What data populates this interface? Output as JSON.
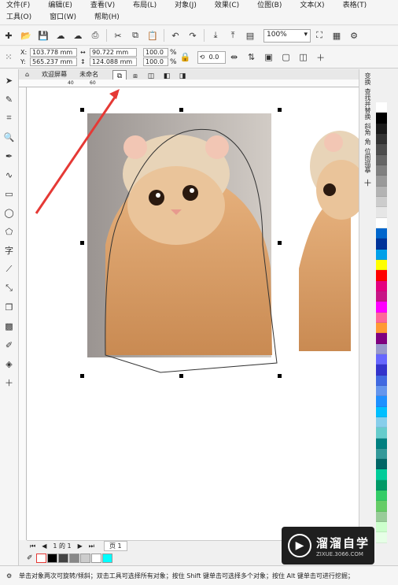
{
  "menubar": {
    "items": [
      "文件(F)",
      "编辑(E)",
      "查看(V)",
      "布局(L)",
      "对象(J)",
      "效果(C)",
      "位图(B)",
      "文本(X)",
      "表格(T)",
      "工具(O)",
      "窗口(W)",
      "帮助(H)"
    ]
  },
  "toolbar": {
    "zoom": "100%"
  },
  "propbar": {
    "x_label": "X:",
    "x_value": "103.778 mm",
    "y_label": "Y:",
    "y_value": "565.237 mm",
    "w_value": "90.722 mm",
    "h_value": "124.088 mm",
    "scale_w": "100.0",
    "scale_h": "100.0",
    "pct_symbol": "%",
    "rotation": "0.0"
  },
  "tabs": {
    "welcome": "欢迎屏幕",
    "untitled": "未命名"
  },
  "ruler": {
    "tick_40": "40",
    "tick_60": "60"
  },
  "dock": {
    "labels": [
      "变换",
      "查找并替换",
      "斜角",
      "角",
      "位图描摹"
    ]
  },
  "palette_colors": [
    "#ffffff",
    "#000000",
    "#1a1a1a",
    "#333333",
    "#4d4d4d",
    "#666666",
    "#808080",
    "#999999",
    "#b3b3b3",
    "#cccccc",
    "#e6e6e6",
    "#ffffff",
    "#0066cc",
    "#003399",
    "#00a0e9",
    "#ffff00",
    "#ff0000",
    "#e4007f",
    "#c71585",
    "#ff00ff",
    "#ff6699",
    "#ff9933",
    "#800080",
    "#9999cc",
    "#6666ff",
    "#3333cc",
    "#4169e1",
    "#6495ed",
    "#1e90ff",
    "#00bfff",
    "#87ceeb",
    "#66cccc",
    "#008080",
    "#339999",
    "#006666",
    "#00cc99",
    "#009966",
    "#33cc66",
    "#66cc66",
    "#99cc99",
    "#ccffcc",
    "#e6ffe6"
  ],
  "pagebar": {
    "page_label": "页 1",
    "page_count": "1 的 1"
  },
  "bottom_swatches": [
    "#000000",
    "#444444",
    "#888888",
    "#cccccc",
    "#ffffff",
    "#00ffff"
  ],
  "statusbar": {
    "text": "单击对象两次可旋转/倾斜；双击工具可选择所有对象；按住 Shift 键单击可选择多个对象；按住 Alt 键单击可进行挖掘；"
  },
  "watermark": {
    "title": "溜溜自学",
    "url": "ZIXUE.3066.COM"
  }
}
